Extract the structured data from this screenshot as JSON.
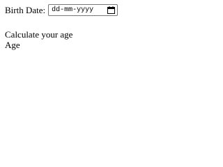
{
  "form": {
    "birth_date_label": "Birth Date:",
    "birth_date_placeholder": "dd-mm-yyyy",
    "calendar_icon": "calendar-icon",
    "calculate_text": "Calculate your age",
    "age_text": "Age"
  }
}
